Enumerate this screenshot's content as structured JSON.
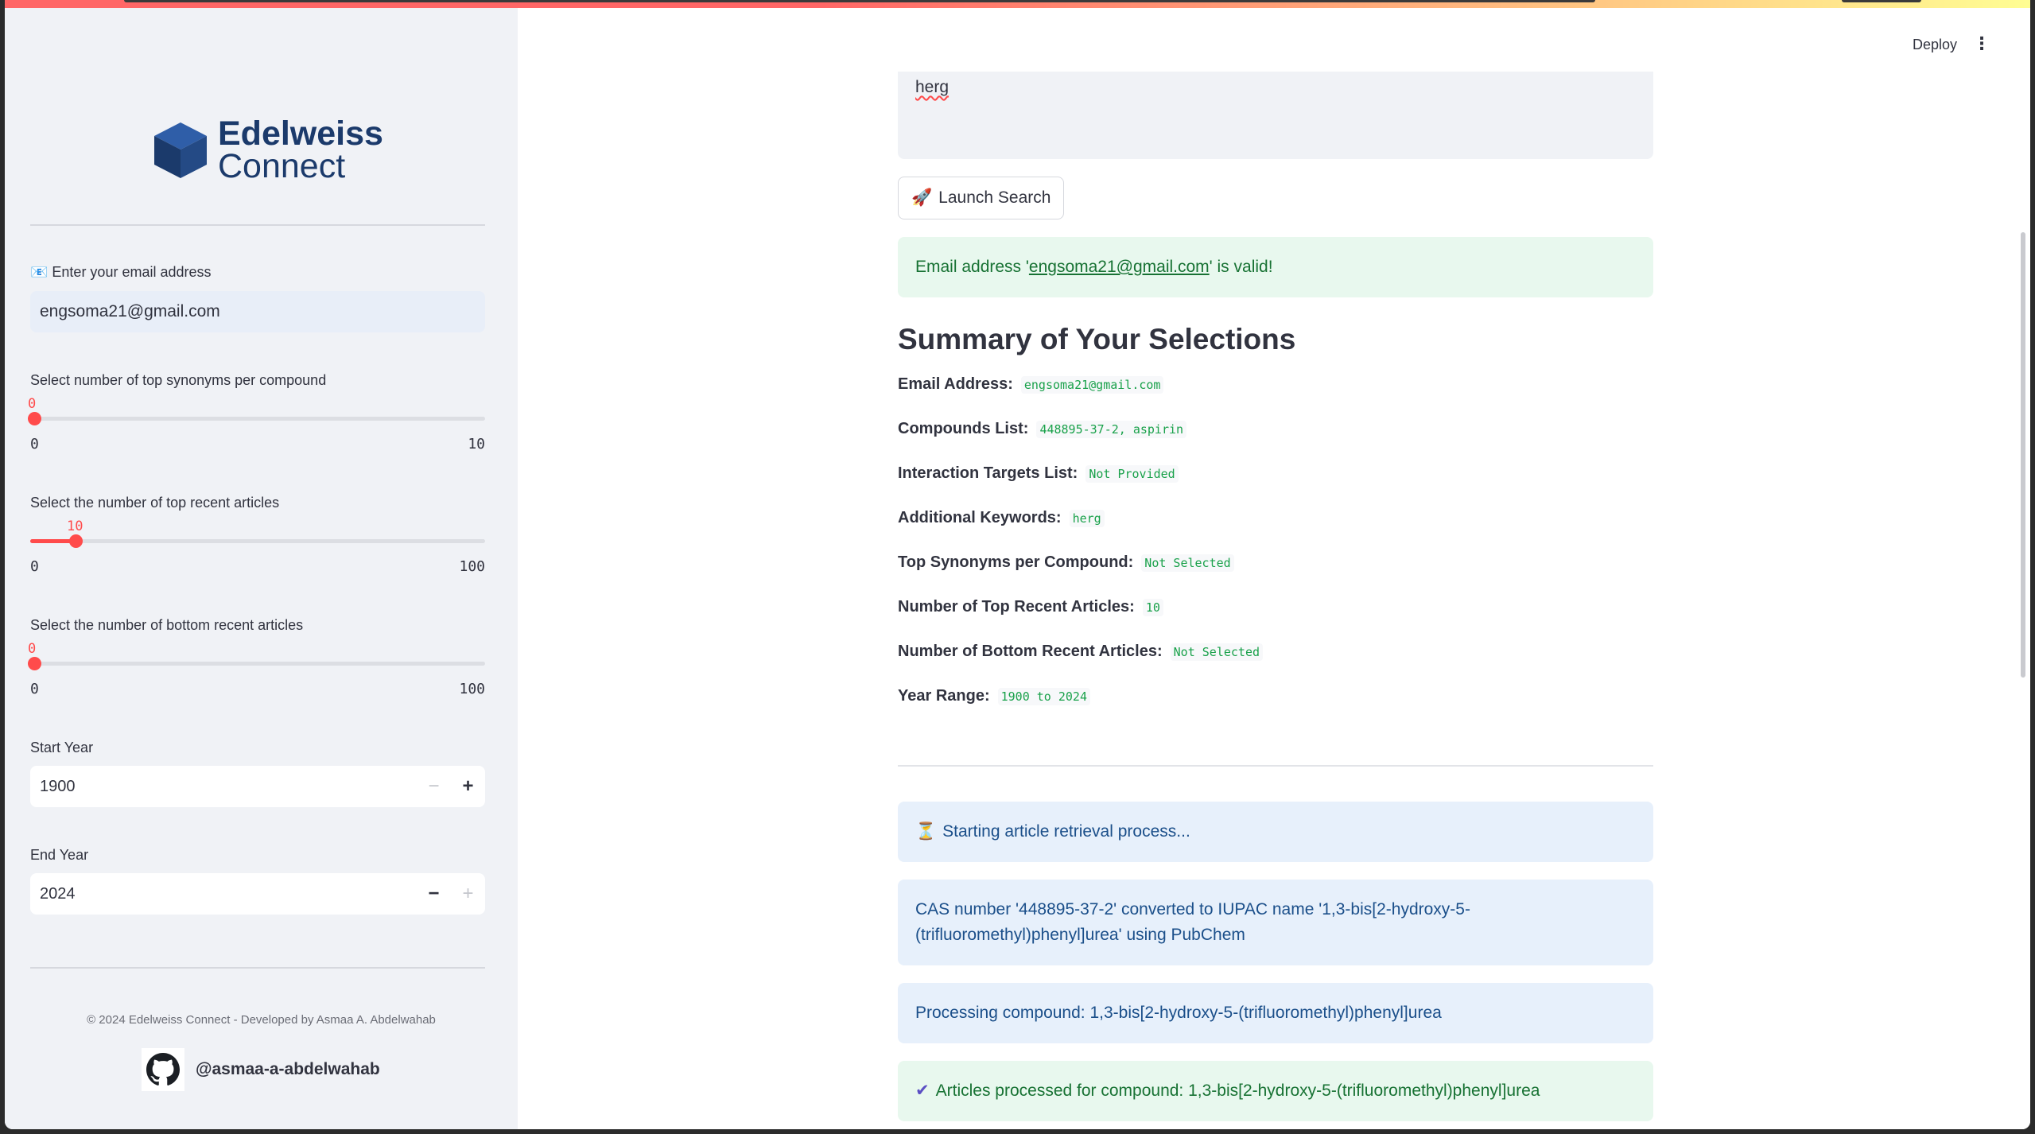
{
  "sidebar": {
    "logo": {
      "line1": "Edelweiss",
      "line2": "Connect"
    },
    "email_label": "📧 Enter your email address",
    "email_value": "engsoma21@gmail.com",
    "synonyms": {
      "label": "Select number of top synonyms per compound",
      "value": "0",
      "min": "0",
      "max": "10",
      "level": 0
    },
    "top_articles": {
      "label": "Select the number of top recent articles",
      "value": "10",
      "min": "0",
      "max": "100",
      "level": 0.1
    },
    "bottom_articles": {
      "label": "Select the number of bottom recent articles",
      "value": "0",
      "min": "0",
      "max": "100",
      "level": 0
    },
    "start_year": {
      "label": "Start Year",
      "value": "1900",
      "minus": "−",
      "plus": "+"
    },
    "end_year": {
      "label": "End Year",
      "value": "2024",
      "minus": "−",
      "plus": "+"
    },
    "footer": "© 2024 Edelweiss Connect - Developed by Asmaa A. Abdelwahab",
    "github": "@asmaa-a-abdelwahab"
  },
  "header": {
    "deploy": "Deploy",
    "menu": "⋮"
  },
  "main": {
    "keywords_text": "herg",
    "launch_label": "Launch Search",
    "launch_icon": "🚀",
    "email_valid": {
      "pre": "Email address '",
      "email": "engsoma21@gmail.com",
      "post": "' is valid!"
    },
    "summary_title": "Summary of Your Selections",
    "summary": [
      {
        "label": "Email Address:",
        "value": "engsoma21@gmail.com"
      },
      {
        "label": "Compounds List:",
        "value": "448895-37-2, aspirin"
      },
      {
        "label": "Interaction Targets List:",
        "value": "Not Provided"
      },
      {
        "label": "Additional Keywords:",
        "value": "herg"
      },
      {
        "label": "Top Synonyms per Compound:",
        "value": "Not Selected"
      },
      {
        "label": "Number of Top Recent Articles:",
        "value": "10"
      },
      {
        "label": "Number of Bottom Recent Articles:",
        "value": "Not Selected"
      },
      {
        "label": "Year Range:",
        "value": "1900 to 2024"
      }
    ],
    "status": {
      "starting_icon": "⏳",
      "starting": "Starting article retrieval process...",
      "converted": "CAS number '448895-37-2' converted to IUPAC name '1,3-bis[2-hydroxy-5-(trifluoromethyl)phenyl]urea' using PubChem",
      "processing": "Processing compound: 1,3-bis[2-hydroxy-5-(trifluoromethyl)phenyl]urea",
      "processed_icon": "✔",
      "processed": "Articles processed for compound: 1,3-bis[2-hydroxy-5-(trifluoromethyl)phenyl]urea"
    }
  },
  "colors": {
    "accent": "#ff4b4b",
    "success_bg": "#e8f8ee",
    "info_bg": "#e7f0fb",
    "brand": "#1b3a6b"
  }
}
